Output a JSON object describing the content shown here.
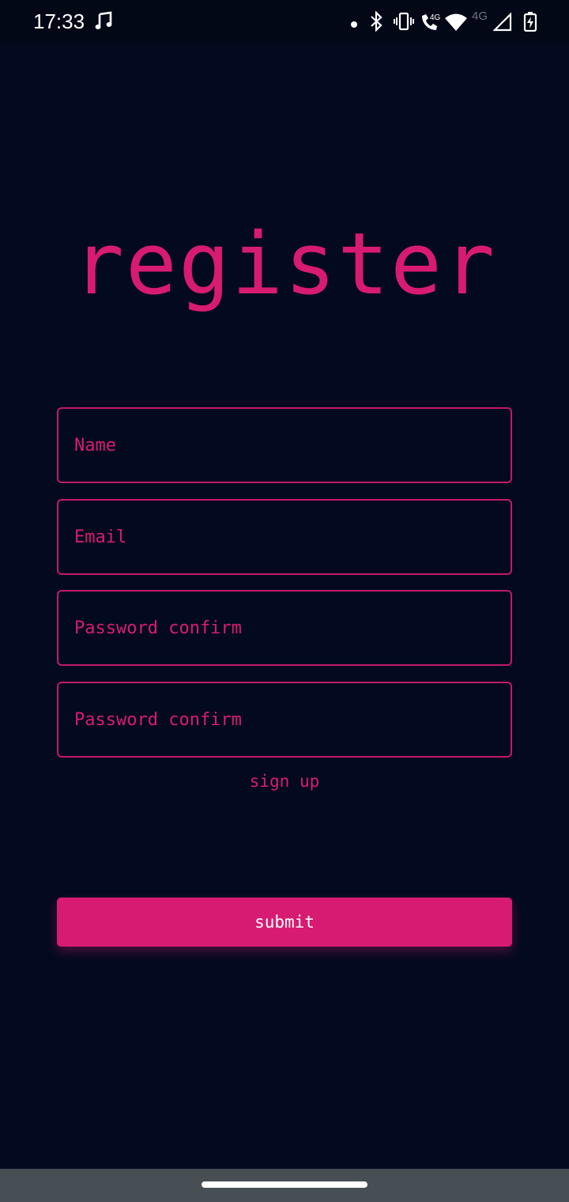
{
  "status_bar": {
    "time": "17:33",
    "network_label_primary": "4G",
    "network_label_secondary": "4G",
    "icons": [
      "music-note-icon",
      "dot-icon",
      "bluetooth-icon",
      "vibrate-icon",
      "call-4g-icon",
      "wifi-icon",
      "signal-icon",
      "battery-charging-icon"
    ]
  },
  "page": {
    "title": "register"
  },
  "form": {
    "name_placeholder": "Name",
    "email_placeholder": "Email",
    "password_placeholder": "Password confirm",
    "password_confirm_placeholder": "Password confirm"
  },
  "actions": {
    "signup_link": "sign up",
    "submit_label": "submit"
  },
  "colors": {
    "background": "#030a1f",
    "accent": "#d81b72",
    "nav_bar": "#474e54"
  }
}
